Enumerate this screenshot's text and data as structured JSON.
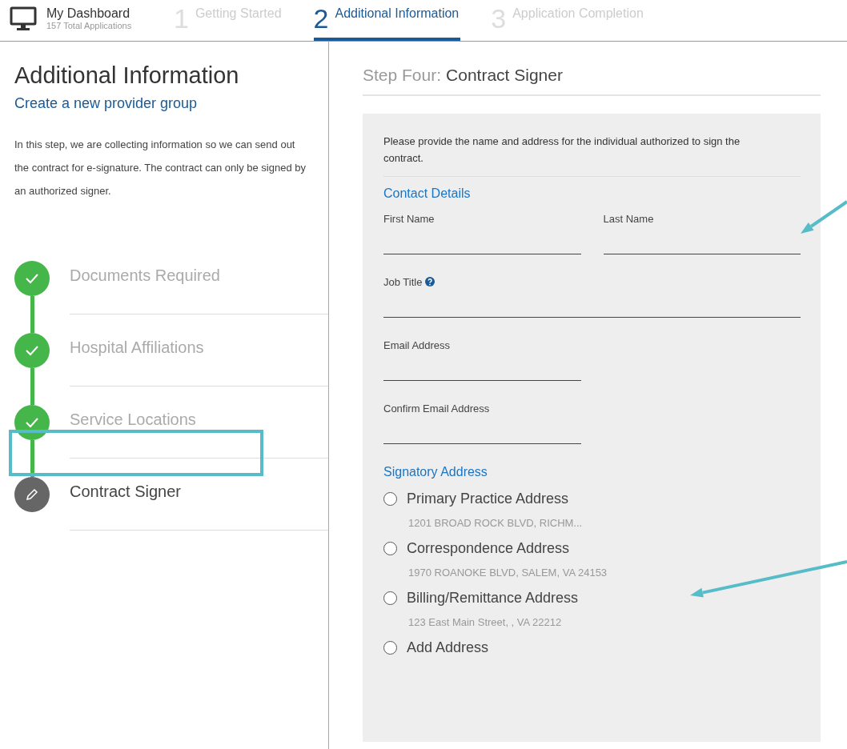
{
  "nav": {
    "dashboard": {
      "title": "My Dashboard",
      "subtitle": "157 Total Applications"
    },
    "steps": [
      {
        "number": "1",
        "label": "Getting Started",
        "selected": false
      },
      {
        "number": "2",
        "label": "Additional Information",
        "selected": true
      },
      {
        "number": "3",
        "label": "Application Completion",
        "selected": false
      }
    ]
  },
  "sidebar": {
    "title": "Additional Information",
    "link": "Create a new provider group",
    "description": "In this step, we are collecting information so we can send out the contract for e-signature. The contract can only be signed by an authorized signer.",
    "steps": [
      {
        "label": "Documents Required",
        "completed": true,
        "current": false
      },
      {
        "label": "Hospital Affiliations",
        "completed": true,
        "current": false
      },
      {
        "label": "Service Locations",
        "completed": true,
        "current": false
      },
      {
        "label": "Contract Signer",
        "current": true
      }
    ]
  },
  "main": {
    "heading_prefix": "Step Four:",
    "heading": "Contract Signer",
    "intro": "Please provide the name and address for the individual authorized to sign the contract.",
    "contact_title": "Contact Details",
    "field_rows": [
      [
        {
          "label": "First Name",
          "kind": "half",
          "help": false
        },
        {
          "label": "Last Name",
          "kind": "half",
          "help": false
        }
      ],
      [
        {
          "label": "Job Title",
          "kind": "full",
          "help": true
        }
      ],
      [
        {
          "label": "Email Address",
          "kind": "half",
          "help": false
        }
      ],
      [
        {
          "label": "Confirm Email Address",
          "kind": "half",
          "help": false
        }
      ]
    ],
    "address_title": "Signatory Address",
    "addresses": [
      {
        "label": "Primary Practice Address",
        "detail": "1201 BROAD ROCK BLVD, RICHM...",
        "selected": false
      },
      {
        "label": "Correspondence Address",
        "detail": "1970 ROANOKE BLVD, SALEM, VA 24153",
        "selected": false
      },
      {
        "label": "Billing/Remittance Address",
        "detail": "123 East Main Street, , VA 22212",
        "selected": false
      },
      {
        "label": "Add Address",
        "selected": false
      }
    ]
  },
  "annotations": [
    {
      "kind": "box"
    },
    {
      "kind": "arrow"
    },
    {
      "kind": "arrow"
    }
  ]
}
